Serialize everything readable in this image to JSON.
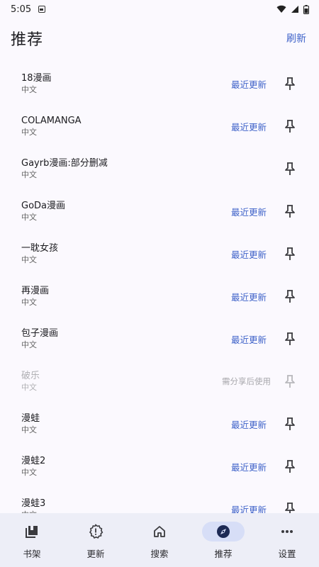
{
  "status_bar": {
    "time": "5:05"
  },
  "header": {
    "title": "推荐",
    "refresh_label": "刷新"
  },
  "sources": [
    {
      "name": "18漫画",
      "lang": "中文",
      "action": "最近更新",
      "disabled": false
    },
    {
      "name": "COLAMANGA",
      "lang": "中文",
      "action": "最近更新",
      "disabled": false
    },
    {
      "name": "Gayrb漫画:部分删减",
      "lang": "中文",
      "action": "",
      "disabled": false
    },
    {
      "name": "GoDa漫画",
      "lang": "中文",
      "action": "最近更新",
      "disabled": false
    },
    {
      "name": "一耽女孩",
      "lang": "中文",
      "action": "最近更新",
      "disabled": false
    },
    {
      "name": "再漫画",
      "lang": "中文",
      "action": "最近更新",
      "disabled": false
    },
    {
      "name": "包子漫画",
      "lang": "中文",
      "action": "最近更新",
      "disabled": false
    },
    {
      "name": "破乐",
      "lang": "中文",
      "action": "需分享后使用",
      "disabled": true
    },
    {
      "name": "漫蛙",
      "lang": "中文",
      "action": "最近更新",
      "disabled": false
    },
    {
      "name": "漫蛙2",
      "lang": "中文",
      "action": "最近更新",
      "disabled": false
    },
    {
      "name": "漫蛙3",
      "lang": "中文",
      "action": "最近更新",
      "disabled": false
    }
  ],
  "pin_icon": "pin-icon",
  "bottom_nav": [
    {
      "label": "书架",
      "icon": "bookshelf-icon",
      "active": false
    },
    {
      "label": "更新",
      "icon": "update-alert-icon",
      "active": false
    },
    {
      "label": "搜索",
      "icon": "home-icon",
      "active": false
    },
    {
      "label": "推荐",
      "icon": "compass-icon",
      "active": true
    },
    {
      "label": "设置",
      "icon": "more-dots-icon",
      "active": false
    }
  ],
  "colors": {
    "accent": "#3f63c9",
    "nav_bg": "#edeef7",
    "active_pill": "#d7def7",
    "background": "#fbf9fe"
  }
}
